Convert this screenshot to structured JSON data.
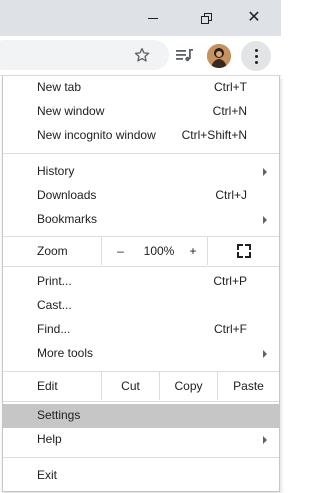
{
  "window": {
    "minimize_icon": "minimize-icon",
    "maximize_icon": "restore-icon",
    "close_icon": "close-icon",
    "close_glyph": "✕"
  },
  "toolbar": {
    "star_icon": "star-icon",
    "media_icon": "media-playlist-icon",
    "avatar_icon": "profile-avatar",
    "menu_icon": "more-vert-icon"
  },
  "menu": {
    "new_tab": {
      "label": "New tab",
      "shortcut": "Ctrl+T"
    },
    "new_window": {
      "label": "New window",
      "shortcut": "Ctrl+N"
    },
    "new_incognito": {
      "label": "New incognito window",
      "shortcut": "Ctrl+Shift+N"
    },
    "history": {
      "label": "History"
    },
    "downloads": {
      "label": "Downloads",
      "shortcut": "Ctrl+J"
    },
    "bookmarks": {
      "label": "Bookmarks"
    },
    "zoom": {
      "label": "Zoom",
      "minus": "–",
      "level": "100%",
      "plus": "+"
    },
    "print": {
      "label": "Print...",
      "shortcut": "Ctrl+P"
    },
    "cast": {
      "label": "Cast..."
    },
    "find": {
      "label": "Find...",
      "shortcut": "Ctrl+F"
    },
    "more_tools": {
      "label": "More tools"
    },
    "edit": {
      "label": "Edit",
      "cut": "Cut",
      "copy": "Copy",
      "paste": "Paste"
    },
    "settings": {
      "label": "Settings"
    },
    "help": {
      "label": "Help"
    },
    "exit": {
      "label": "Exit"
    }
  },
  "colors": {
    "titlebar": "#dee1e6",
    "hover": "#c6c6c6",
    "separator": "#dadce0"
  }
}
